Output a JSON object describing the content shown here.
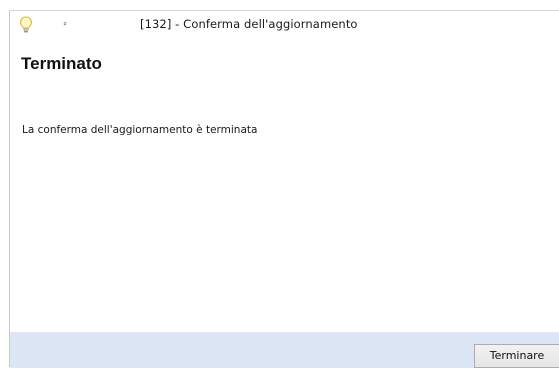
{
  "window": {
    "title": "[132] - Conferma dell'aggiornamento",
    "quick_access_glyph": "⸗",
    "icon": "lightbulb-icon"
  },
  "content": {
    "heading": "Terminato",
    "message": "La conferma dell'aggiornamento è terminata"
  },
  "footer": {
    "finish_label": "Terminare",
    "background": "#dce6f4"
  }
}
